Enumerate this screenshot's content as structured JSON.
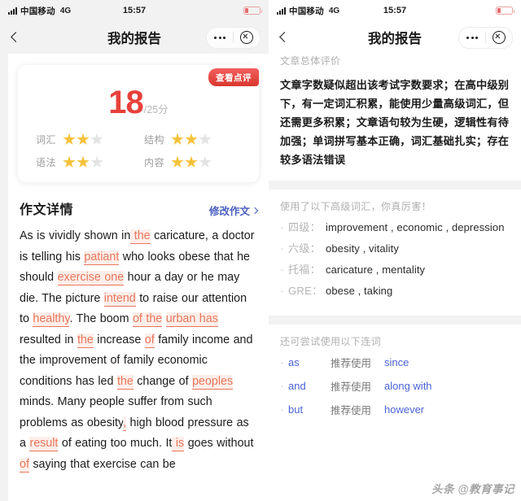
{
  "left": {
    "status": {
      "carrier": "中国移动",
      "network": "4G",
      "time": "15:57"
    },
    "nav": {
      "title": "我的报告"
    },
    "score_card": {
      "badge": "查看点评",
      "score": "18",
      "total": "/25分",
      "metrics": [
        {
          "label": "词汇",
          "filled": 2,
          "total": 3
        },
        {
          "label": "结构",
          "filled": 2,
          "total": 3
        },
        {
          "label": "语法",
          "filled": 2,
          "total": 3
        },
        {
          "label": "内容",
          "filled": 2,
          "total": 3
        }
      ]
    },
    "essay": {
      "title": "作文详情",
      "edit_link": "修改作文",
      "segments": [
        {
          "text": "As is vividly shown in",
          "corrected": false
        },
        {
          "text": " the",
          "corrected": true
        },
        {
          "text": " caricature, a doctor is telling his ",
          "corrected": false
        },
        {
          "text": "patiant",
          "corrected": true
        },
        {
          "text": " who looks obese that he should ",
          "corrected": false
        },
        {
          "text": "exercise one",
          "corrected": true
        },
        {
          "text": " hour a day or he may die. The picture ",
          "corrected": false
        },
        {
          "text": "intend",
          "corrected": true
        },
        {
          "text": " to raise our attention to ",
          "corrected": false
        },
        {
          "text": "healthy",
          "corrected": true
        },
        {
          "text": ". The boom ",
          "corrected": false
        },
        {
          "text": "of the",
          "corrected": true
        },
        {
          "text": " ",
          "corrected": false
        },
        {
          "text": "urban has",
          "corrected": true
        },
        {
          "text": " resulted in ",
          "corrected": false
        },
        {
          "text": "the",
          "corrected": true
        },
        {
          "text": " increase ",
          "corrected": false
        },
        {
          "text": "of",
          "corrected": true
        },
        {
          "text": " family income and the improvement of family economic conditions has led ",
          "corrected": false
        },
        {
          "text": "the",
          "corrected": true
        },
        {
          "text": " change of ",
          "corrected": false
        },
        {
          "text": "peoples",
          "corrected": true
        },
        {
          "text": " minds. Many people suffer from such problems as obesity",
          "corrected": false
        },
        {
          "text": ",",
          "corrected": true
        },
        {
          "text": " high blood pressure as a ",
          "corrected": false
        },
        {
          "text": "result",
          "corrected": true
        },
        {
          "text": " of eating too much. It",
          "corrected": false
        },
        {
          "text": " is",
          "corrected": true
        },
        {
          "text": " goes without ",
          "corrected": false
        },
        {
          "text": "of",
          "corrected": true
        },
        {
          "text": " saying that exercise can be",
          "corrected": false
        }
      ]
    }
  },
  "right": {
    "status": {
      "carrier": "中国移动",
      "network": "4G",
      "time": "15:57"
    },
    "nav": {
      "title": "我的报告"
    },
    "summary": {
      "label": "文章总体评价",
      "text": "文章字数疑似超出该考试字数要求；在高中级别下，有一定词汇积累，能使用少量高级词汇，但还需更多积累；文章语句较为生硬，逻辑性有待加强；单词拼写基本正确，词汇基础扎实；存在较多语法错误"
    },
    "vocabulary": {
      "label": "使用了以下高级词汇，你真厉害！",
      "items": [
        {
          "level": "四级：",
          "words": "improvement , economic , depression"
        },
        {
          "level": "六级：",
          "words": "obesity , vitality"
        },
        {
          "level": "托福：",
          "words": "caricature , mentality"
        },
        {
          "level": "GRE：",
          "words": "obese , taking"
        }
      ]
    },
    "conjunctions": {
      "label": "还可尝试使用以下连词",
      "items": [
        {
          "from": "as",
          "mid": "推荐使用",
          "to": "since"
        },
        {
          "from": "and",
          "mid": "推荐使用",
          "to": "along with"
        },
        {
          "from": "but",
          "mid": "推荐使用",
          "to": "however"
        }
      ]
    }
  },
  "watermark": "头条 @教育事记"
}
